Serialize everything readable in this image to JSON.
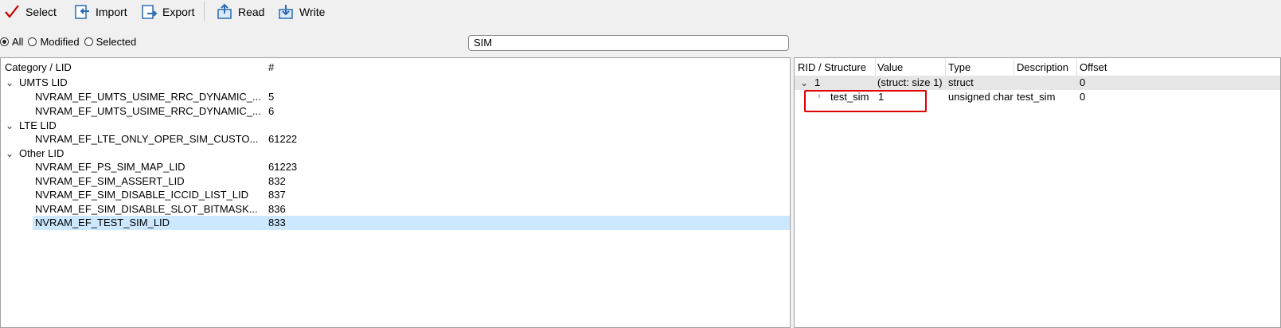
{
  "toolbar": {
    "select": "Select",
    "import": "Import",
    "export": "Export",
    "read": "Read",
    "write": "Write"
  },
  "filter": {
    "all": "All",
    "modified": "Modified",
    "selected": "Selected",
    "selected_option": "All",
    "search_value": "SIM"
  },
  "left_table": {
    "col_name": "Category / LID",
    "col_num": "#",
    "groups": [
      {
        "name": "UMTS LID",
        "items": [
          {
            "name": "NVRAM_EF_UMTS_USIME_RRC_DYNAMIC_...",
            "num": "5"
          },
          {
            "name": "NVRAM_EF_UMTS_USIME_RRC_DYNAMIC_...",
            "num": "6"
          }
        ]
      },
      {
        "name": "LTE LID",
        "items": [
          {
            "name": "NVRAM_EF_LTE_ONLY_OPER_SIM_CUSTO...",
            "num": "61222"
          }
        ]
      },
      {
        "name": "Other LID",
        "items": [
          {
            "name": "NVRAM_EF_PS_SIM_MAP_LID",
            "num": "61223"
          },
          {
            "name": "NVRAM_EF_SIM_ASSERT_LID",
            "num": "832"
          },
          {
            "name": "NVRAM_EF_SIM_DISABLE_ICCID_LIST_LID",
            "num": "837"
          },
          {
            "name": "NVRAM_EF_SIM_DISABLE_SLOT_BITMASK...",
            "num": "836"
          },
          {
            "name": "NVRAM_EF_TEST_SIM_LID",
            "num": "833"
          }
        ]
      }
    ]
  },
  "right_table": {
    "col_rid": "RID / Structure",
    "col_value": "Value",
    "col_type": "Type",
    "col_desc": "Description",
    "col_offset": "Offset",
    "rows": [
      {
        "rid": "1",
        "value": "(struct: size 1)",
        "type": "struct",
        "desc": "",
        "offset": "0"
      },
      {
        "rid": "test_sim",
        "value": "1",
        "type": "unsigned char",
        "desc": "test_sim",
        "offset": "0"
      }
    ]
  },
  "colors": {
    "selection": "#cce8ff",
    "highlight_box": "#e00000",
    "check": "#cc0000",
    "icon_blue": "#2b6cb0"
  }
}
